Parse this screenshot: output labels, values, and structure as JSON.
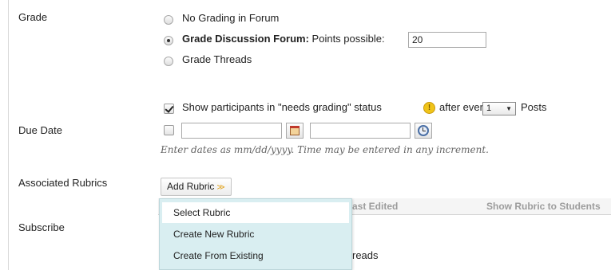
{
  "grade": {
    "label": "Grade",
    "options": [
      {
        "label": "No Grading in Forum",
        "selected": false
      },
      {
        "label_bold": "Grade Discussion Forum:",
        "label_rest": "Points possible:",
        "selected": true
      },
      {
        "label": "Grade Threads",
        "selected": false
      }
    ],
    "points_value": "20"
  },
  "needs_grading": {
    "checked": true,
    "label_before": "Show participants in \"needs grading\" status",
    "label_after": "after every",
    "posts_value": "1",
    "label_posts": "Posts"
  },
  "due_date": {
    "label": "Due Date",
    "checked": false,
    "date_value": "",
    "time_value": "",
    "hint": "Enter dates as mm/dd/yyyy. Time may be entered in any increment."
  },
  "rubrics": {
    "label": "Associated Rubrics",
    "add_button": "Add Rubric",
    "columns": [
      "ast Edited",
      "Show Rubric to Students"
    ],
    "menu": [
      "Select Rubric",
      "Create New Rubric",
      "Create From Existing"
    ]
  },
  "subscribe": {
    "label": "Subscribe",
    "partial_text": "reads"
  },
  "colors": {
    "menu_bg": "#d9eef1",
    "accent_chevron": "#e2a21a",
    "info_icon": "#f0c419"
  }
}
